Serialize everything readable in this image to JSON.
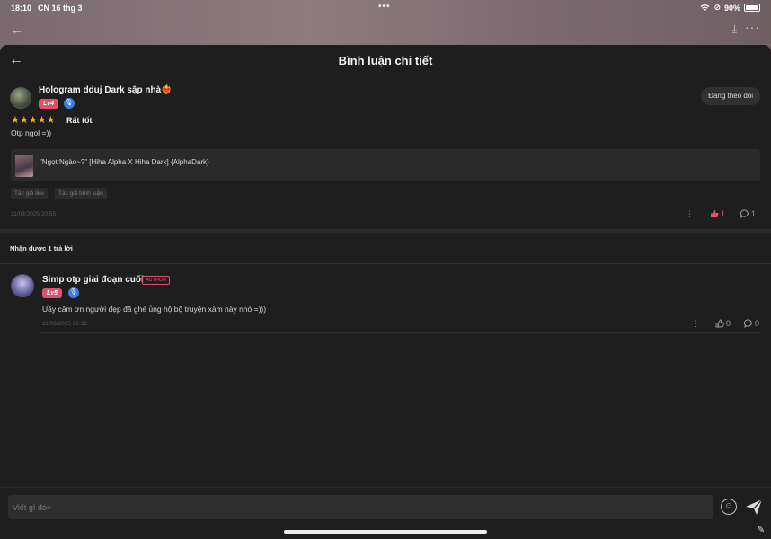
{
  "status_bar": {
    "time": "18:10",
    "date": "CN 16 thg 3",
    "dots": "•••",
    "battery": "90%"
  },
  "header": {
    "title": "Bình luận chi tiết"
  },
  "comment": {
    "username": "Hologram dduj Dark sập nhà❤️‍🔥",
    "level": "Lv4",
    "follow_label": "Đang theo dõi",
    "stars": "★★★★★",
    "rating_label": "Rất tốt",
    "text": "Otp ngol =))",
    "story_title": "\"Ngọt Ngào~?\" [Hiha Alpha X Hiha Dark] {AlphaDark}",
    "tags": [
      "Tác giả like",
      "Tác giả bình luận"
    ],
    "timestamp": "11/03/2025 20:55",
    "likes": "1",
    "replies": "1"
  },
  "replies_label": "Nhận được 1 trả lời",
  "reply": {
    "username": "Simp otp giai đoạn cuối",
    "author_badge": "AUTHOR",
    "level": "Lv5",
    "text": "Uầy cảm ơn người đẹp đã ghé ủng hộ bộ truyện xàm này nhó =)))",
    "timestamp": "11/03/2025 22:32",
    "likes": "0",
    "replies": "0"
  },
  "input": {
    "placeholder": "Viết gì đó>"
  },
  "colors": {
    "accent": "#e0506a",
    "star": "#f5b400",
    "sheet_bg": "#1e1e1e"
  }
}
